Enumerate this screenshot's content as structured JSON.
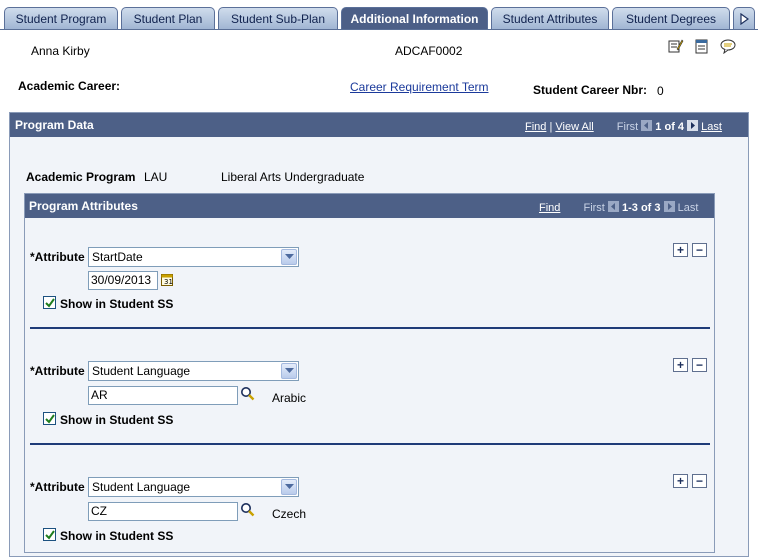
{
  "tabs": [
    {
      "label": "Student Program",
      "active": false
    },
    {
      "label": "Student Plan",
      "active": false
    },
    {
      "label": "Student Sub-Plan",
      "active": false
    },
    {
      "label": "Additional Information",
      "active": true
    },
    {
      "label": "Student Attributes",
      "active": false
    },
    {
      "label": "Student Degrees",
      "active": false
    }
  ],
  "header": {
    "student_name": "Anna Kirby",
    "student_id": "ADCAF0002",
    "academic_career_label": "Academic Career:",
    "career_requirement_term_link": "Career Requirement Term",
    "student_career_nbr_label": "Student Career Nbr:",
    "student_career_nbr_value": "0",
    "tool_icons": [
      "edit-notes-icon",
      "notepad-icon",
      "comment-icon"
    ]
  },
  "program_data": {
    "title": "Program Data",
    "nav": {
      "find": "Find",
      "separator": "|",
      "view_all": "View All",
      "first": "First",
      "range": "1 of 4",
      "last": "Last"
    },
    "academic_program_label": "Academic Program",
    "academic_program_code": "LAU",
    "academic_program_desc": "Liberal Arts Undergraduate"
  },
  "program_attributes": {
    "title": "Program Attributes",
    "nav": {
      "find": "Find",
      "first": "First",
      "range": "1-3 of 3",
      "last": "Last"
    },
    "attribute_label": "*Attribute",
    "show_label": "Show in Student SS",
    "rows": [
      {
        "attribute": "StartDate",
        "value": "30/09/2013",
        "value_desc": "",
        "show": true
      },
      {
        "attribute": "Student Language",
        "value": "AR",
        "value_desc": "Arabic",
        "show": true
      },
      {
        "attribute": "Student Language",
        "value": "CZ",
        "value_desc": "Czech",
        "show": true
      }
    ],
    "add_symbol": "+",
    "remove_symbol": "−"
  },
  "colors": {
    "header_bar": "#4d6087",
    "panel_bg": "#f1f4f9",
    "link": "#1b3a9b",
    "active_tab": "#4c5f87"
  }
}
